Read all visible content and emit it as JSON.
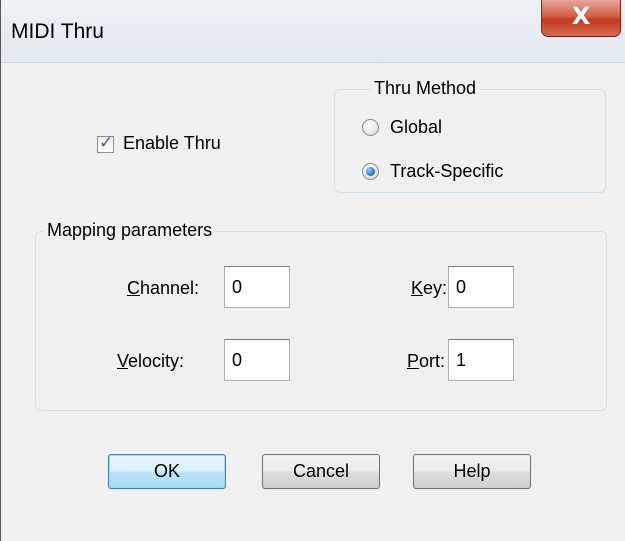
{
  "window": {
    "title": "MIDI Thru",
    "close_glyph": "X"
  },
  "enable_thru": {
    "label": "Enable Thru",
    "checked": true
  },
  "thru_method": {
    "group_label": "Thru Method",
    "options": [
      {
        "label": "Global",
        "selected": false
      },
      {
        "label": "Track-Specific",
        "selected": true
      }
    ]
  },
  "mapping": {
    "group_label": "Mapping parameters",
    "channel": {
      "mnemonic": "C",
      "label_rest": "hannel:",
      "value": "0"
    },
    "key": {
      "mnemonic": "K",
      "label_rest": "ey:",
      "value": "0"
    },
    "velocity": {
      "mnemonic": "V",
      "label_rest": "elocity:",
      "value": "0"
    },
    "port": {
      "mnemonic": "P",
      "label_rest": "ort:",
      "value": "1"
    }
  },
  "buttons": {
    "ok": "OK",
    "cancel": "Cancel",
    "help": "Help"
  },
  "colors": {
    "close_button": "#c94a32",
    "default_button_border": "#3c7fb1",
    "checkmark": "#4a5f97"
  }
}
